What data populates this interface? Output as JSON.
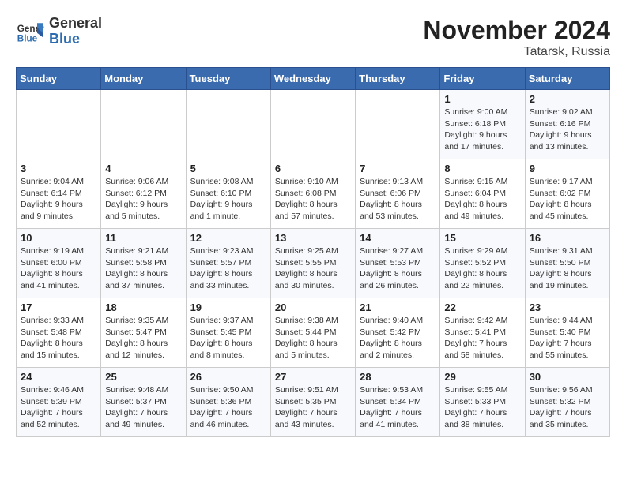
{
  "header": {
    "logo_general": "General",
    "logo_blue": "Blue",
    "month": "November 2024",
    "location": "Tatarsk, Russia"
  },
  "days_of_week": [
    "Sunday",
    "Monday",
    "Tuesday",
    "Wednesday",
    "Thursday",
    "Friday",
    "Saturday"
  ],
  "weeks": [
    [
      {
        "day": "",
        "text": ""
      },
      {
        "day": "",
        "text": ""
      },
      {
        "day": "",
        "text": ""
      },
      {
        "day": "",
        "text": ""
      },
      {
        "day": "",
        "text": ""
      },
      {
        "day": "1",
        "text": "Sunrise: 9:00 AM\nSunset: 6:18 PM\nDaylight: 9 hours and 17 minutes."
      },
      {
        "day": "2",
        "text": "Sunrise: 9:02 AM\nSunset: 6:16 PM\nDaylight: 9 hours and 13 minutes."
      }
    ],
    [
      {
        "day": "3",
        "text": "Sunrise: 9:04 AM\nSunset: 6:14 PM\nDaylight: 9 hours and 9 minutes."
      },
      {
        "day": "4",
        "text": "Sunrise: 9:06 AM\nSunset: 6:12 PM\nDaylight: 9 hours and 5 minutes."
      },
      {
        "day": "5",
        "text": "Sunrise: 9:08 AM\nSunset: 6:10 PM\nDaylight: 9 hours and 1 minute."
      },
      {
        "day": "6",
        "text": "Sunrise: 9:10 AM\nSunset: 6:08 PM\nDaylight: 8 hours and 57 minutes."
      },
      {
        "day": "7",
        "text": "Sunrise: 9:13 AM\nSunset: 6:06 PM\nDaylight: 8 hours and 53 minutes."
      },
      {
        "day": "8",
        "text": "Sunrise: 9:15 AM\nSunset: 6:04 PM\nDaylight: 8 hours and 49 minutes."
      },
      {
        "day": "9",
        "text": "Sunrise: 9:17 AM\nSunset: 6:02 PM\nDaylight: 8 hours and 45 minutes."
      }
    ],
    [
      {
        "day": "10",
        "text": "Sunrise: 9:19 AM\nSunset: 6:00 PM\nDaylight: 8 hours and 41 minutes."
      },
      {
        "day": "11",
        "text": "Sunrise: 9:21 AM\nSunset: 5:58 PM\nDaylight: 8 hours and 37 minutes."
      },
      {
        "day": "12",
        "text": "Sunrise: 9:23 AM\nSunset: 5:57 PM\nDaylight: 8 hours and 33 minutes."
      },
      {
        "day": "13",
        "text": "Sunrise: 9:25 AM\nSunset: 5:55 PM\nDaylight: 8 hours and 30 minutes."
      },
      {
        "day": "14",
        "text": "Sunrise: 9:27 AM\nSunset: 5:53 PM\nDaylight: 8 hours and 26 minutes."
      },
      {
        "day": "15",
        "text": "Sunrise: 9:29 AM\nSunset: 5:52 PM\nDaylight: 8 hours and 22 minutes."
      },
      {
        "day": "16",
        "text": "Sunrise: 9:31 AM\nSunset: 5:50 PM\nDaylight: 8 hours and 19 minutes."
      }
    ],
    [
      {
        "day": "17",
        "text": "Sunrise: 9:33 AM\nSunset: 5:48 PM\nDaylight: 8 hours and 15 minutes."
      },
      {
        "day": "18",
        "text": "Sunrise: 9:35 AM\nSunset: 5:47 PM\nDaylight: 8 hours and 12 minutes."
      },
      {
        "day": "19",
        "text": "Sunrise: 9:37 AM\nSunset: 5:45 PM\nDaylight: 8 hours and 8 minutes."
      },
      {
        "day": "20",
        "text": "Sunrise: 9:38 AM\nSunset: 5:44 PM\nDaylight: 8 hours and 5 minutes."
      },
      {
        "day": "21",
        "text": "Sunrise: 9:40 AM\nSunset: 5:42 PM\nDaylight: 8 hours and 2 minutes."
      },
      {
        "day": "22",
        "text": "Sunrise: 9:42 AM\nSunset: 5:41 PM\nDaylight: 7 hours and 58 minutes."
      },
      {
        "day": "23",
        "text": "Sunrise: 9:44 AM\nSunset: 5:40 PM\nDaylight: 7 hours and 55 minutes."
      }
    ],
    [
      {
        "day": "24",
        "text": "Sunrise: 9:46 AM\nSunset: 5:39 PM\nDaylight: 7 hours and 52 minutes."
      },
      {
        "day": "25",
        "text": "Sunrise: 9:48 AM\nSunset: 5:37 PM\nDaylight: 7 hours and 49 minutes."
      },
      {
        "day": "26",
        "text": "Sunrise: 9:50 AM\nSunset: 5:36 PM\nDaylight: 7 hours and 46 minutes."
      },
      {
        "day": "27",
        "text": "Sunrise: 9:51 AM\nSunset: 5:35 PM\nDaylight: 7 hours and 43 minutes."
      },
      {
        "day": "28",
        "text": "Sunrise: 9:53 AM\nSunset: 5:34 PM\nDaylight: 7 hours and 41 minutes."
      },
      {
        "day": "29",
        "text": "Sunrise: 9:55 AM\nSunset: 5:33 PM\nDaylight: 7 hours and 38 minutes."
      },
      {
        "day": "30",
        "text": "Sunrise: 9:56 AM\nSunset: 5:32 PM\nDaylight: 7 hours and 35 minutes."
      }
    ]
  ]
}
